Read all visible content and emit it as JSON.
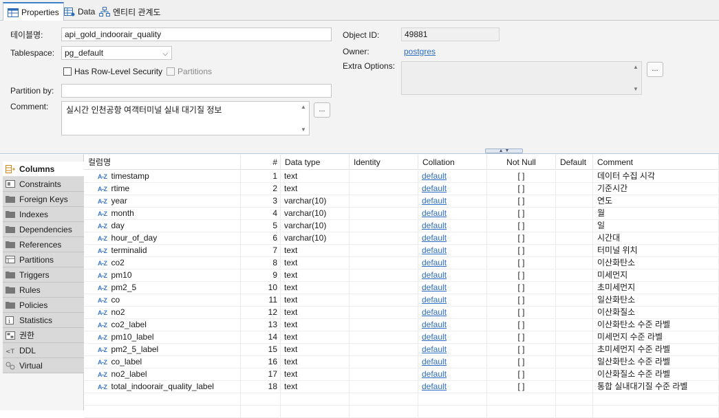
{
  "tabs": [
    {
      "label": "Properties",
      "icon": "table-icon"
    },
    {
      "label": "Data",
      "icon": "grid-data-icon"
    },
    {
      "label": "엔티티 관계도",
      "icon": "diagram-icon"
    }
  ],
  "props": {
    "table_name_label": "테이블명:",
    "table_name": "api_gold_indoorair_quality",
    "tablespace_label": "Tablespace:",
    "tablespace": "pg_default",
    "row_level_security_label": "Has Row-Level Security",
    "partitions_label": "Partitions",
    "partition_by_label": "Partition by:",
    "partition_by": "",
    "comment_label": "Comment:",
    "comment": "실시간 인천공항 여객터미널 실내 대기질 정보",
    "object_id_label": "Object ID:",
    "object_id": "49881",
    "owner_label": "Owner:",
    "owner": "postgres",
    "extra_options_label": "Extra Options:",
    "dots_label": "..."
  },
  "sidebar": [
    {
      "label": "Columns",
      "icon": "columns-icon"
    },
    {
      "label": "Constraints",
      "icon": "constraints-icon"
    },
    {
      "label": "Foreign Keys",
      "icon": "folder-icon"
    },
    {
      "label": "Indexes",
      "icon": "folder-icon"
    },
    {
      "label": "Dependencies",
      "icon": "folder-icon"
    },
    {
      "label": "References",
      "icon": "folder-icon"
    },
    {
      "label": "Partitions",
      "icon": "partitions-icon"
    },
    {
      "label": "Triggers",
      "icon": "folder-icon"
    },
    {
      "label": "Rules",
      "icon": "folder-icon"
    },
    {
      "label": "Policies",
      "icon": "folder-icon"
    },
    {
      "label": "Statistics",
      "icon": "info-icon"
    },
    {
      "label": "권한",
      "icon": "permissions-icon"
    },
    {
      "label": "DDL",
      "icon": "ddl-icon"
    },
    {
      "label": "Virtual",
      "icon": "virtual-icon"
    }
  ],
  "columns_table": {
    "headers": [
      "컬럼명",
      "#",
      "Data type",
      "Identity",
      "Collation",
      "Not Null",
      "Default",
      "Comment"
    ],
    "type_badge": "A-Z",
    "rows": [
      {
        "name": "timestamp",
        "num": "1",
        "type": "text",
        "collation": "default",
        "not_null": "[ ]",
        "comment": "데이터 수집 시각"
      },
      {
        "name": "rtime",
        "num": "2",
        "type": "text",
        "collation": "default",
        "not_null": "[ ]",
        "comment": "기준시간"
      },
      {
        "name": "year",
        "num": "3",
        "type": "varchar(10)",
        "collation": "default",
        "not_null": "[ ]",
        "comment": "연도"
      },
      {
        "name": "month",
        "num": "4",
        "type": "varchar(10)",
        "collation": "default",
        "not_null": "[ ]",
        "comment": "월"
      },
      {
        "name": "day",
        "num": "5",
        "type": "varchar(10)",
        "collation": "default",
        "not_null": "[ ]",
        "comment": "일"
      },
      {
        "name": "hour_of_day",
        "num": "6",
        "type": "varchar(10)",
        "collation": "default",
        "not_null": "[ ]",
        "comment": "시간대"
      },
      {
        "name": "terminalid",
        "num": "7",
        "type": "text",
        "collation": "default",
        "not_null": "[ ]",
        "comment": "터미널 위치"
      },
      {
        "name": "co2",
        "num": "8",
        "type": "text",
        "collation": "default",
        "not_null": "[ ]",
        "comment": "이산화탄소"
      },
      {
        "name": "pm10",
        "num": "9",
        "type": "text",
        "collation": "default",
        "not_null": "[ ]",
        "comment": "미세먼지"
      },
      {
        "name": "pm2_5",
        "num": "10",
        "type": "text",
        "collation": "default",
        "not_null": "[ ]",
        "comment": "초미세먼지"
      },
      {
        "name": "co",
        "num": "11",
        "type": "text",
        "collation": "default",
        "not_null": "[ ]",
        "comment": "일산화탄소"
      },
      {
        "name": "no2",
        "num": "12",
        "type": "text",
        "collation": "default",
        "not_null": "[ ]",
        "comment": "이산화질소"
      },
      {
        "name": "co2_label",
        "num": "13",
        "type": "text",
        "collation": "default",
        "not_null": "[ ]",
        "comment": "이산화탄소 수준 라벨"
      },
      {
        "name": "pm10_label",
        "num": "14",
        "type": "text",
        "collation": "default",
        "not_null": "[ ]",
        "comment": "미세먼지 수준 라벨"
      },
      {
        "name": "pm2_5_label",
        "num": "15",
        "type": "text",
        "collation": "default",
        "not_null": "[ ]",
        "comment": "초미세먼지 수준 라벨"
      },
      {
        "name": "co_label",
        "num": "16",
        "type": "text",
        "collation": "default",
        "not_null": "[ ]",
        "comment": "일산화탄소 수준 라벨"
      },
      {
        "name": "no2_label",
        "num": "17",
        "type": "text",
        "collation": "default",
        "not_null": "[ ]",
        "comment": "이산화질소 수준 라벨"
      },
      {
        "name": "total_indoorair_quality_label",
        "num": "18",
        "type": "text",
        "collation": "default",
        "not_null": "[ ]",
        "comment": "통합 실내대기질 수준 라벨"
      }
    ]
  }
}
